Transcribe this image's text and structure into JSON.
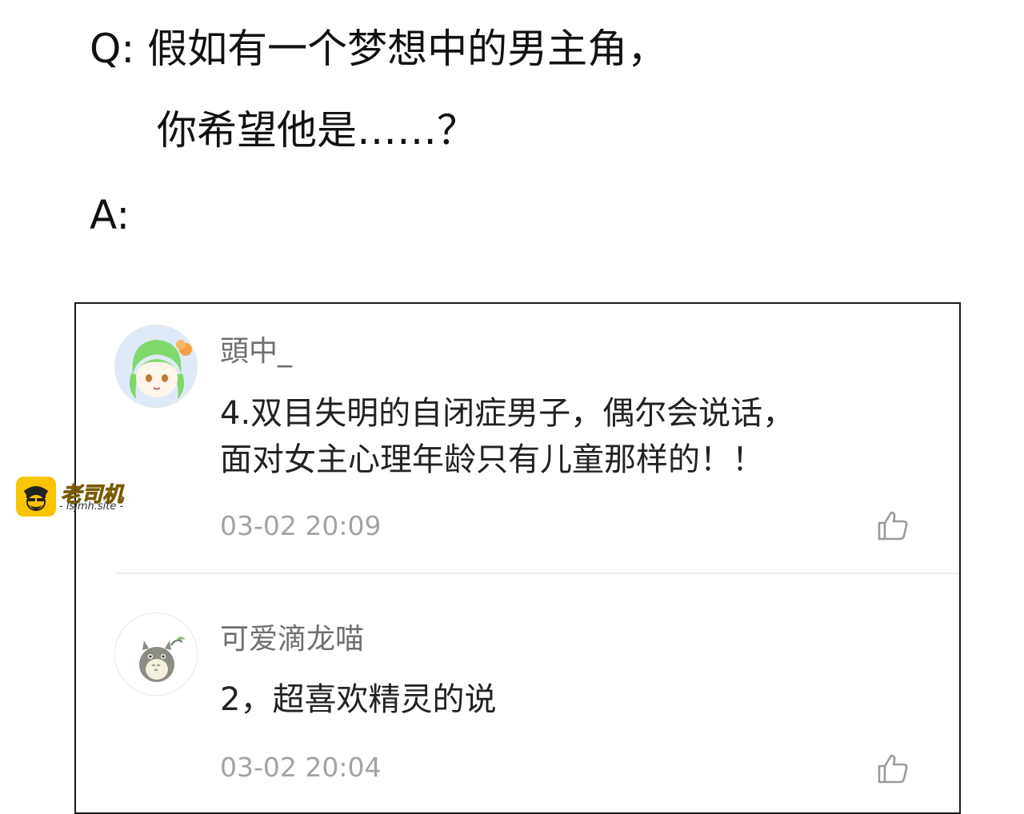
{
  "qa": {
    "question_line1": "Q: 假如有一个梦想中的男主角，",
    "question_line2": "你希望他是……？",
    "answer_label": "A:"
  },
  "comments": [
    {
      "username": "頭中_",
      "text_line1": "4.双目失明的自闭症男子，偶尔会说话，",
      "text_line2": "面对女主心理年龄只有儿童那样的！！",
      "time": "03-02 20:09",
      "avatar_icon": "green-hair-anime-girl-avatar",
      "like_icon": "thumbs-up-icon"
    },
    {
      "username": "可爱滴龙喵",
      "text_line1": "2，超喜欢精灵的说",
      "time": "03-02 20:04",
      "avatar_icon": "totoro-avatar",
      "like_icon": "thumbs-up-icon"
    }
  ],
  "watermark": {
    "brand": "老司机",
    "site": "- lsjmh.site -",
    "badge_icon": "driver-face-icon",
    "color": "#f9c400"
  }
}
